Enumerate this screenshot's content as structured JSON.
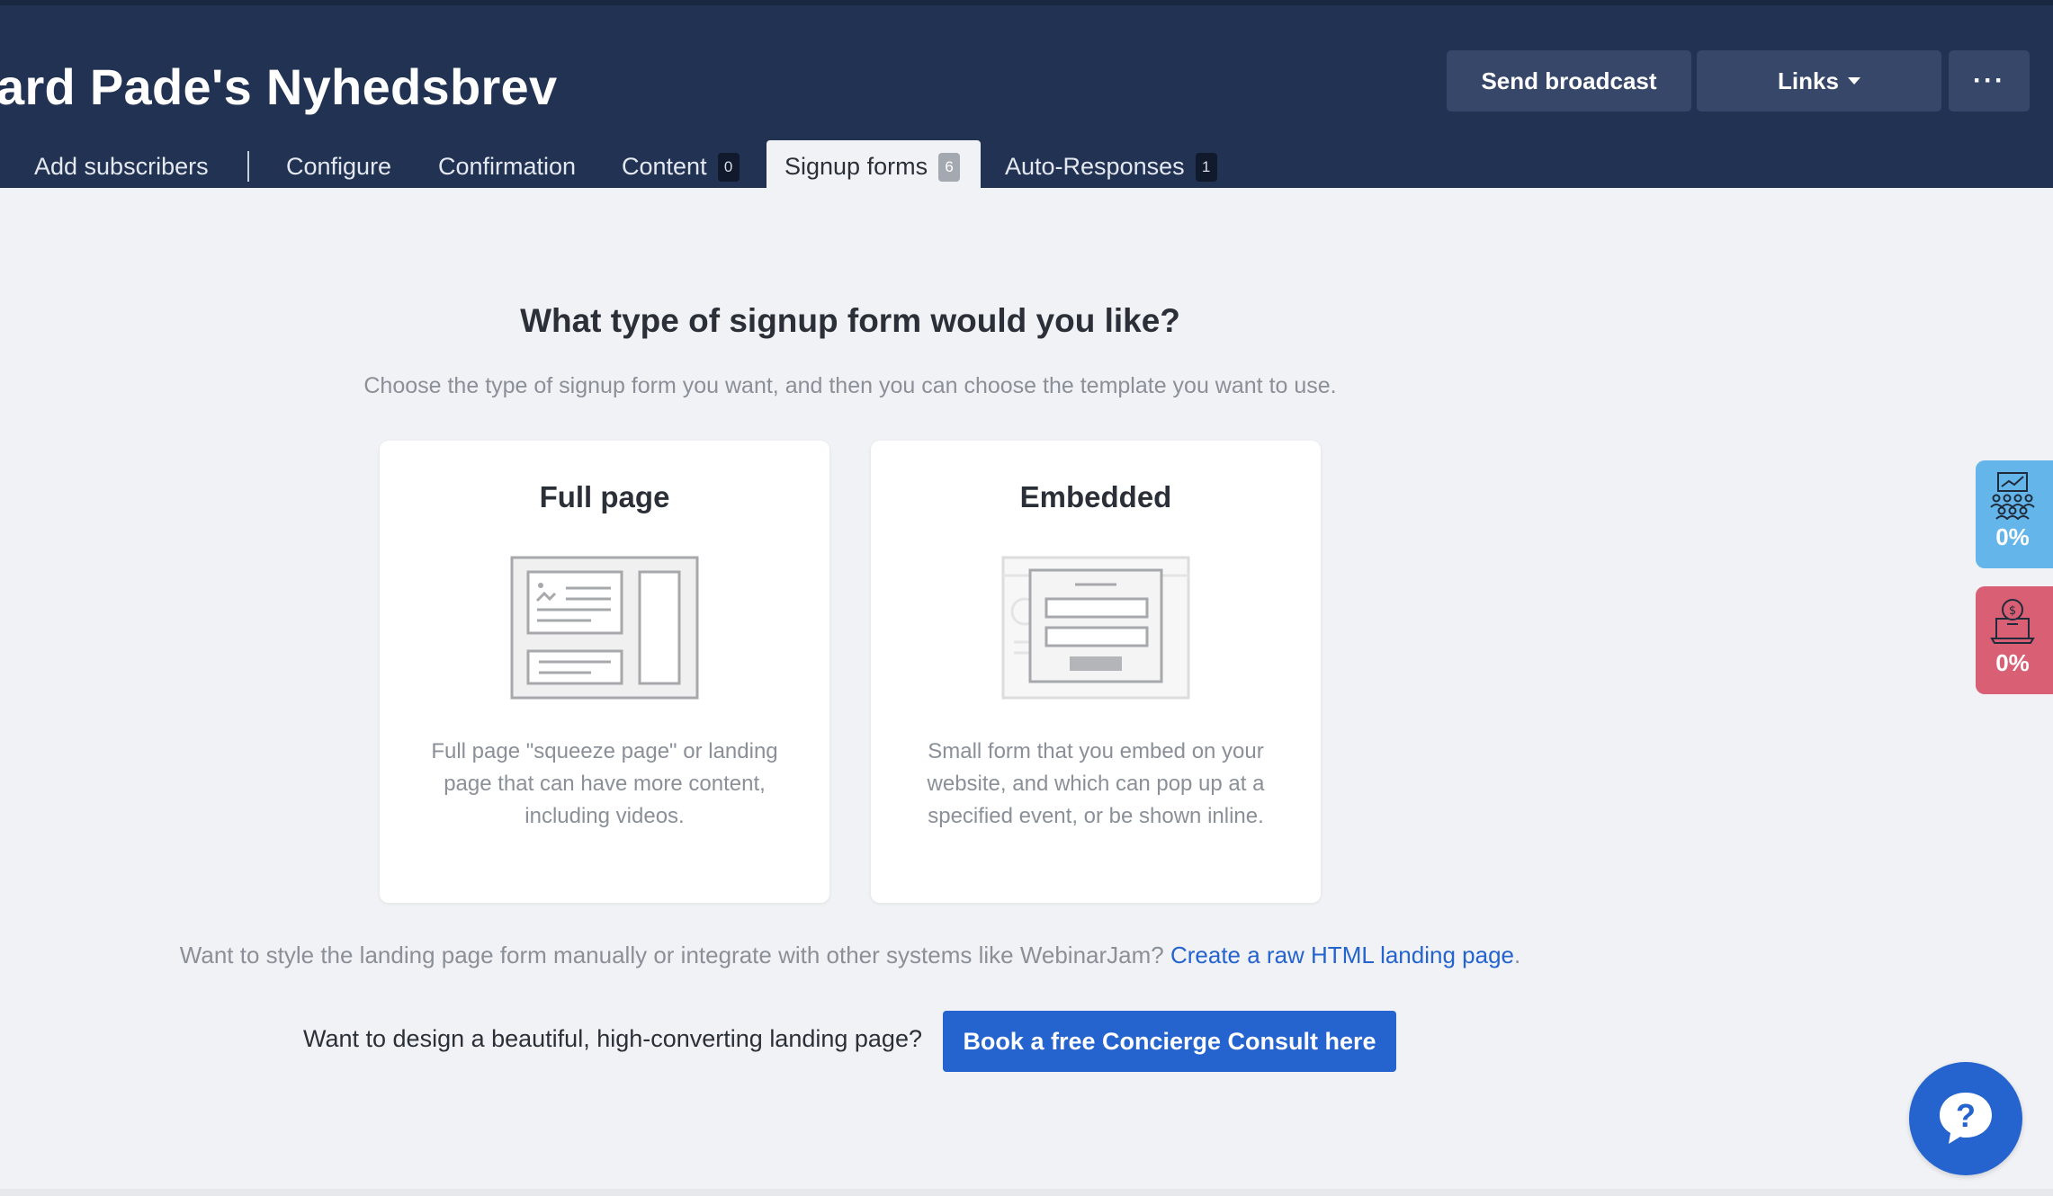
{
  "header": {
    "list_title": "ard Pade's Nyhedsbrev",
    "send_broadcast": "Send broadcast",
    "links": "Links",
    "more": "···",
    "bg_color": "#223252"
  },
  "tabs": [
    {
      "label": "Add subscribers"
    },
    {
      "label": "Configure"
    },
    {
      "label": "Confirmation"
    },
    {
      "label": "Content",
      "count": "0"
    },
    {
      "label": "Signup forms",
      "count": "6",
      "active": true
    },
    {
      "label": "Auto-Responses",
      "count": "1"
    }
  ],
  "main": {
    "heading": "What type of signup form would you like?",
    "subheading": "Choose the type of signup form you want, and then you can choose the template you want to use.",
    "cards": [
      {
        "title": "Full page",
        "icon": "full-page-layout-icon",
        "description": "Full page \"squeeze page\" or landing page that can have more content, including videos."
      },
      {
        "title": "Embedded",
        "icon": "embedded-form-icon",
        "description": "Small form that you embed on your website, and which can pop up at a specified event, or be shown inline."
      }
    ],
    "raw_text": "Want to style the landing page form manually or integrate with other systems like WebinarJam? ",
    "raw_link": "Create a raw HTML landing page",
    "raw_suffix": ".",
    "consult_text": "Want to design a beautiful, high-converting landing page?",
    "consult_button": "Book a free Concierge Consult here"
  },
  "side_widgets": [
    {
      "icon": "audience-growth-icon",
      "value": "0%",
      "color": "#64b5e9"
    },
    {
      "icon": "revenue-laptop-icon",
      "value": "0%",
      "color": "#d95f74"
    }
  ],
  "help": {
    "icon": "help-chat-icon",
    "glyph": "?"
  },
  "colors": {
    "accent": "#2563cf",
    "background": "#f1f2f5"
  }
}
